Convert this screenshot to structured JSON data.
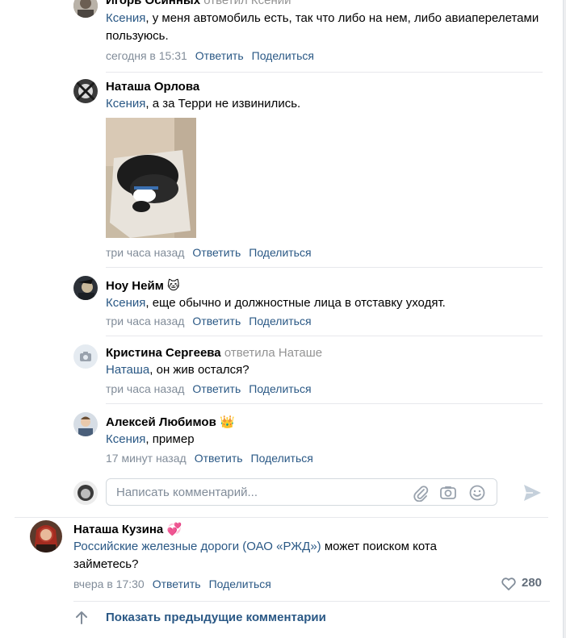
{
  "comments": [
    {
      "author": "Игорь Осинных",
      "reply_to": "ответил Ксении",
      "mention": "Ксения",
      "text": ", у меня автомобиль есть, так что либо на нем, либо авиаперелетами пользуюсь.",
      "time": "сегодня в 15:31",
      "reply_label": "Ответить",
      "share_label": "Поделиться"
    },
    {
      "author": "Наташа Орлова",
      "mention": "Ксения",
      "text": ", а за Терри не извинились.",
      "time": "три часа назад",
      "reply_label": "Ответить",
      "share_label": "Поделиться"
    },
    {
      "author": "Ноу Нейм",
      "badge": "🐱",
      "mention": "Ксения",
      "text": ", еще обычно и должностные лица в отставку уходят.",
      "time": "три часа назад",
      "reply_label": "Ответить",
      "share_label": "Поделиться"
    },
    {
      "author": "Кристина Сергеева",
      "reply_to": "ответила Наташе",
      "mention": "Наташа",
      "text": ", он жив остался?",
      "time": "три часа назад",
      "reply_label": "Ответить",
      "share_label": "Поделиться"
    },
    {
      "author": "Алексей Любимов",
      "badge": "👑",
      "mention": "Ксения",
      "text": ", пример",
      "time": "17 минут назад",
      "reply_label": "Ответить",
      "share_label": "Поделиться"
    }
  ],
  "comment_input": {
    "placeholder": "Написать комментарий..."
  },
  "main_comment": {
    "author": "Наташа Кузина",
    "badge": "💞",
    "mention": "Российские железные дороги (ОАО «РЖД»)",
    "text": " может поиском кота займетесь?",
    "time": "вчера в 17:30",
    "reply_label": "Ответить",
    "share_label": "Поделиться",
    "likes": "280"
  },
  "show_previous_label": "Показать предыдущие комментарии",
  "colors": {
    "link": "#2a5885",
    "meta": "#818c99",
    "separator": "#e7e8ec",
    "background": "#edeef0"
  }
}
